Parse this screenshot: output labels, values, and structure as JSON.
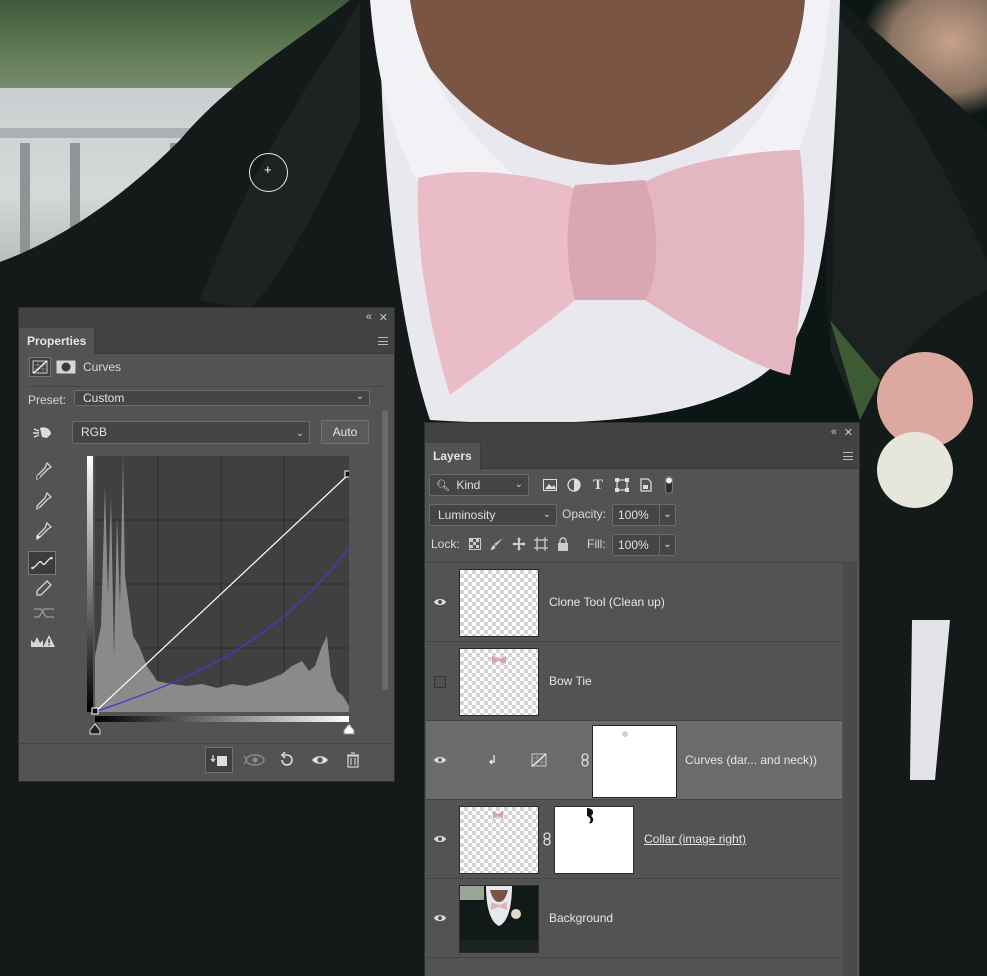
{
  "properties": {
    "tab_label": "Properties",
    "adjustment_name": "Curves",
    "preset_label": "Preset:",
    "preset_value": "Custom",
    "channel_value": "RGB",
    "auto_label": "Auto"
  },
  "layers": {
    "tab_label": "Layers",
    "filter_kind": "Kind",
    "blend_mode": "Luminosity",
    "opacity_label": "Opacity:",
    "opacity_value": "100%",
    "lock_label": "Lock:",
    "fill_label": "Fill:",
    "fill_value": "100%",
    "items": [
      {
        "name": "Clone Tool (Clean up)",
        "visible": true,
        "selected": false
      },
      {
        "name": "Bow Tie",
        "visible": false,
        "selected": false
      },
      {
        "name": "Curves (dar... and neck))",
        "visible": true,
        "selected": true
      },
      {
        "name": "Collar (image right)",
        "visible": true,
        "selected": false
      },
      {
        "name": "Background",
        "visible": true,
        "selected": false
      }
    ]
  },
  "icons": {
    "props_collapse": "collapse-icon",
    "props_close": "close-icon",
    "layers_collapse": "collapse-icon",
    "layers_close": "close-icon"
  },
  "colors": {
    "panel_bg": "#535353",
    "panel_header": "#424242",
    "selected_row": "#6b6b6b",
    "curve_blue": "#3b3bd0",
    "curve_white": "#ffffff"
  }
}
